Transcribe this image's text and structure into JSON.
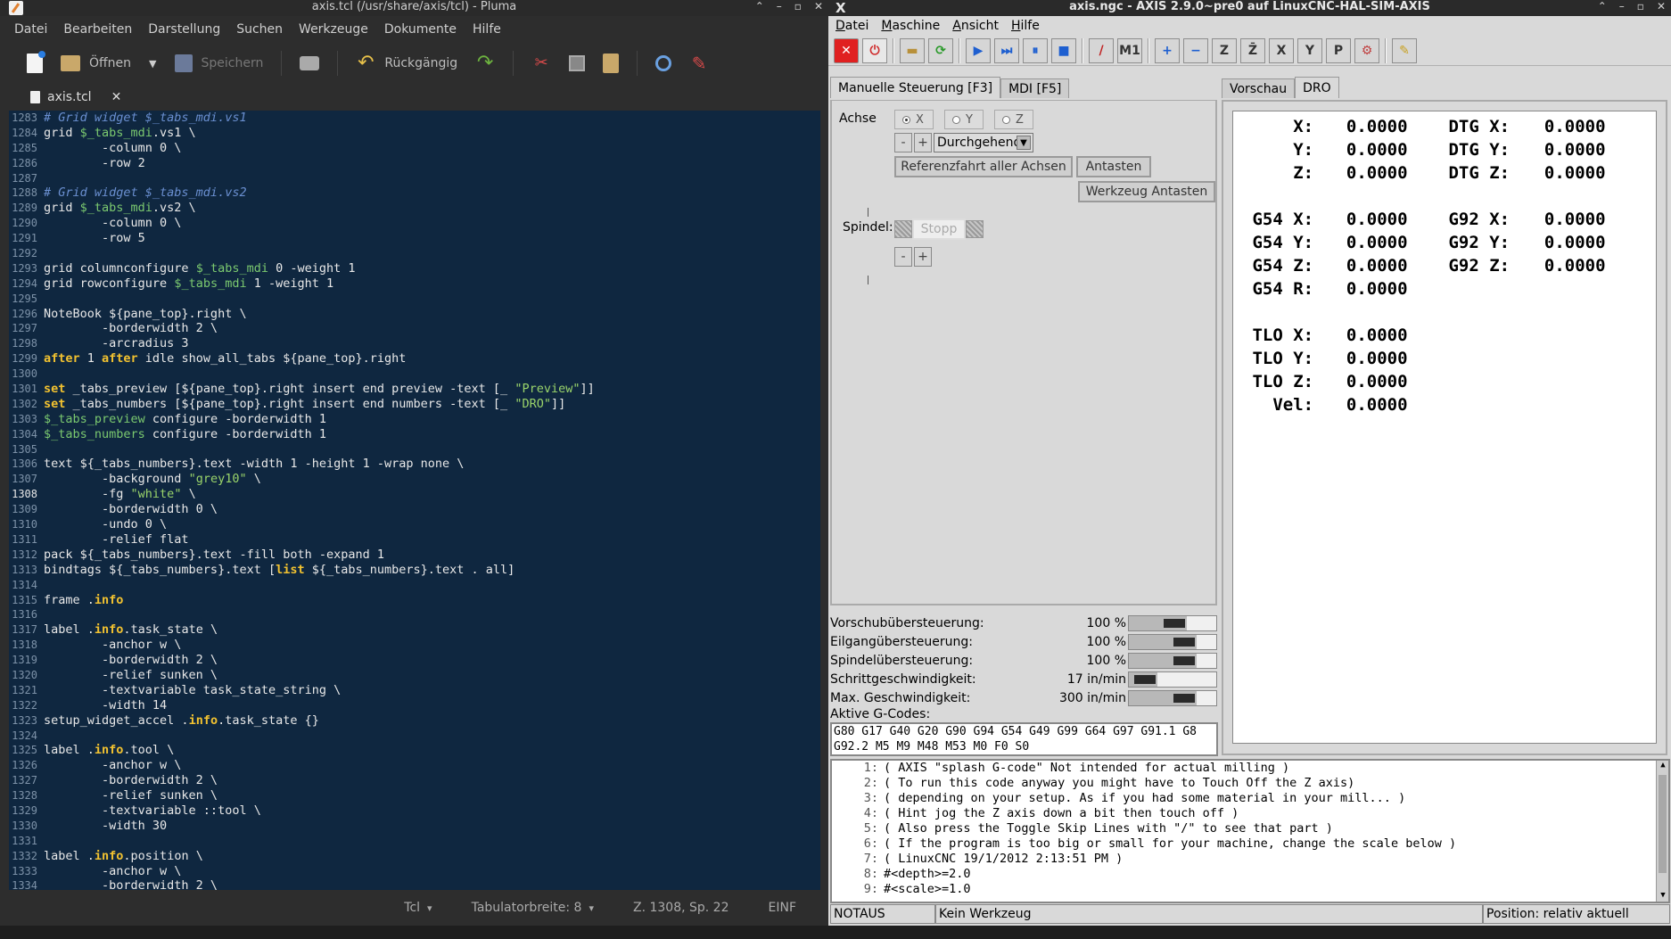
{
  "pluma": {
    "title": "axis.tcl (/usr/share/axis/tcl) - Pluma",
    "menu": [
      "Datei",
      "Bearbeiten",
      "Darstellung",
      "Suchen",
      "Werkzeuge",
      "Dokumente",
      "Hilfe"
    ],
    "toolbar": {
      "open": "Öffnen",
      "save": "Speichern",
      "undo": "Rückgängig"
    },
    "tab": {
      "label": "axis.tcl"
    },
    "status": {
      "language": "Tcl",
      "tabwidth": "Tabulatorbreite:  8",
      "position": "Z. 1308, Sp. 22",
      "mode": "EINF"
    },
    "current_line": "1308",
    "lines": [
      {
        "n": "1283",
        "html": "<span class='c'># Grid widget $_tabs_mdi.vs1</span>"
      },
      {
        "n": "1284",
        "html": "grid <span class='v'>$_tabs_mdi</span>.vs1 \\"
      },
      {
        "n": "1285",
        "html": "        -column 0 \\"
      },
      {
        "n": "1286",
        "html": "        -row 2"
      },
      {
        "n": "1287",
        "html": ""
      },
      {
        "n": "1288",
        "html": "<span class='c'># Grid widget $_tabs_mdi.vs2</span>"
      },
      {
        "n": "1289",
        "html": "grid <span class='v'>$_tabs_mdi</span>.vs2 \\"
      },
      {
        "n": "1290",
        "html": "        -column 0 \\"
      },
      {
        "n": "1291",
        "html": "        -row 5"
      },
      {
        "n": "1292",
        "html": ""
      },
      {
        "n": "1293",
        "html": "grid columnconfigure <span class='v'>$_tabs_mdi</span> 0 -weight 1"
      },
      {
        "n": "1294",
        "html": "grid rowconfigure <span class='v'>$_tabs_mdi</span> 1 -weight 1"
      },
      {
        "n": "1295",
        "html": ""
      },
      {
        "n": "1296",
        "html": "NoteBook ${pane_top}.right \\"
      },
      {
        "n": "1297",
        "html": "        -borderwidth 2 \\"
      },
      {
        "n": "1298",
        "html": "        -arcradius 3"
      },
      {
        "n": "1299",
        "html": "<span class='k'>after</span> 1 <span class='k'>after</span> idle show_all_tabs ${pane_top}.right"
      },
      {
        "n": "1300",
        "html": ""
      },
      {
        "n": "1301",
        "html": "<span class='k'>set</span> _tabs_preview [${pane_top}.right insert end preview -text [_ <span class='s'>\"Preview\"</span>]]"
      },
      {
        "n": "1302",
        "html": "<span class='k'>set</span> _tabs_numbers [${pane_top}.right insert end numbers -text [_ <span class='s'>\"DRO\"</span>]]"
      },
      {
        "n": "1303",
        "html": "<span class='v'>$_tabs_preview</span> configure -borderwidth 1"
      },
      {
        "n": "1304",
        "html": "<span class='v'>$_tabs_numbers</span> configure -borderwidth 1"
      },
      {
        "n": "1305",
        "html": ""
      },
      {
        "n": "1306",
        "html": "text ${_tabs_numbers}.text -width 1 -height 1 -wrap none \\"
      },
      {
        "n": "1307",
        "html": "        -background <span class='s'>\"grey10\"</span> \\"
      },
      {
        "n": "1308",
        "html": "        -fg <span class='s'>\"white\"</span> \\"
      },
      {
        "n": "1309",
        "html": "        -borderwidth 0 \\"
      },
      {
        "n": "1310",
        "html": "        -undo 0 \\"
      },
      {
        "n": "1311",
        "html": "        -relief flat"
      },
      {
        "n": "1312",
        "html": "pack ${_tabs_numbers}.text -fill both -expand 1"
      },
      {
        "n": "1313",
        "html": "bindtags ${_tabs_numbers}.text [<span class='k'>list</span> ${_tabs_numbers}.text . all]"
      },
      {
        "n": "1314",
        "html": ""
      },
      {
        "n": "1315",
        "html": "frame .<span class='k'>info</span>"
      },
      {
        "n": "1316",
        "html": ""
      },
      {
        "n": "1317",
        "html": "label .<span class='k'>info</span>.task_state \\"
      },
      {
        "n": "1318",
        "html": "        -anchor w \\"
      },
      {
        "n": "1319",
        "html": "        -borderwidth 2 \\"
      },
      {
        "n": "1320",
        "html": "        -relief sunken \\"
      },
      {
        "n": "1321",
        "html": "        -textvariable task_state_string \\"
      },
      {
        "n": "1322",
        "html": "        -width 14"
      },
      {
        "n": "1323",
        "html": "setup_widget_accel .<span class='k'>info</span>.task_state {}"
      },
      {
        "n": "1324",
        "html": ""
      },
      {
        "n": "1325",
        "html": "label .<span class='k'>info</span>.tool \\"
      },
      {
        "n": "1326",
        "html": "        -anchor w \\"
      },
      {
        "n": "1327",
        "html": "        -borderwidth 2 \\"
      },
      {
        "n": "1328",
        "html": "        -relief sunken \\"
      },
      {
        "n": "1329",
        "html": "        -textvariable ::tool \\"
      },
      {
        "n": "1330",
        "html": "        -width 30"
      },
      {
        "n": "1331",
        "html": ""
      },
      {
        "n": "1332",
        "html": "label .<span class='k'>info</span>.position \\"
      },
      {
        "n": "1333",
        "html": "        -anchor w \\"
      },
      {
        "n": "1334",
        "html": "        -borderwidth 2 \\"
      }
    ]
  },
  "axis": {
    "title": "axis.ngc - AXIS 2.9.0~pre0 auf LinuxCNC-HAL-SIM-AXIS",
    "menu": [
      "Datei",
      "Maschine",
      "Ansicht",
      "Hilfe"
    ],
    "tabs_left": [
      "Manuelle Steuerung [F3]",
      "MDI [F5]"
    ],
    "tabs_right": [
      "Vorschau",
      "DRO"
    ],
    "manual": {
      "axis_label": "Achse",
      "axes": [
        "X",
        "Y",
        "Z"
      ],
      "minus": "-",
      "plus": "+",
      "jog_mode": "Durchgehend",
      "home_all": "Referenzfahrt aller Achsen",
      "touch_off": "Antasten",
      "tool_touch_off": "Werkzeug Antasten",
      "spindle_label": "Spindel:",
      "spindle_stop": "Stopp"
    },
    "overrides": [
      {
        "name": "Vorschubübersteuerung:",
        "value": "100 %",
        "level": 0.55
      },
      {
        "name": "Eilgangübersteuerung:",
        "value": "100 %",
        "level": 0.7
      },
      {
        "name": "Spindelübersteuerung:",
        "value": "100 %",
        "level": 0.7
      },
      {
        "name": "Schrittgeschwindigkeit:",
        "value": "17 in/min",
        "level": 0.06
      },
      {
        "name": "Max. Geschwindigkeit:",
        "value": "300 in/min",
        "level": 0.7
      }
    ],
    "gcodes_label": "Aktive G-Codes:",
    "gcodes": [
      "G80 G17 G40 G20 G90 G94 G54 G49 G99 G64 G97 G91.1 G8",
      "G92.2 M5 M9 M48 M53 M0 F0 S0"
    ],
    "dro": {
      "rows": [
        {
          "l": "     X:",
          "v": "  0.0000",
          "r": " DTG X:",
          "rv": "  0.0000"
        },
        {
          "l": "     Y:",
          "v": "  0.0000",
          "r": " DTG Y:",
          "rv": "  0.0000"
        },
        {
          "l": "     Z:",
          "v": "  0.0000",
          "r": " DTG Z:",
          "rv": "  0.0000"
        },
        {
          "l": "",
          "v": "",
          "r": "",
          "rv": ""
        },
        {
          "l": " G54 X:",
          "v": "  0.0000",
          "r": " G92 X:",
          "rv": "  0.0000"
        },
        {
          "l": " G54 Y:",
          "v": "  0.0000",
          "r": " G92 Y:",
          "rv": "  0.0000"
        },
        {
          "l": " G54 Z:",
          "v": "  0.0000",
          "r": " G92 Z:",
          "rv": "  0.0000"
        },
        {
          "l": " G54 R:",
          "v": "  0.0000",
          "r": "",
          "rv": ""
        },
        {
          "l": "",
          "v": "",
          "r": "",
          "rv": ""
        },
        {
          "l": " TLO X:",
          "v": "  0.0000",
          "r": "",
          "rv": ""
        },
        {
          "l": " TLO Y:",
          "v": "  0.0000",
          "r": "",
          "rv": ""
        },
        {
          "l": " TLO Z:",
          "v": "  0.0000",
          "r": "",
          "rv": ""
        },
        {
          "l": "   Vel:",
          "v": "  0.0000",
          "r": "",
          "rv": ""
        }
      ]
    },
    "program": [
      {
        "n": "1:",
        "t": "( AXIS \"splash G-code\" Not intended for actual milling )"
      },
      {
        "n": "2:",
        "t": "( To run this code anyway you might have to Touch Off the Z axis)"
      },
      {
        "n": "3:",
        "t": "( depending on your setup. As if you had some material in your mill... )"
      },
      {
        "n": "4:",
        "t": "( Hint jog the Z axis down a bit then touch off )"
      },
      {
        "n": "5:",
        "t": "( Also press the Toggle Skip Lines with \"/\" to see that part )"
      },
      {
        "n": "6:",
        "t": "( If the program is too big or small for your machine, change the scale below )"
      },
      {
        "n": "7:",
        "t": "( LinuxCNC 19/1/2012 2:13:51 PM )"
      },
      {
        "n": "8:",
        "t": "#<depth>=2.0"
      },
      {
        "n": "9:",
        "t": "#<scale>=1.0"
      }
    ],
    "status": {
      "state": "NOTAUS",
      "tool": "Kein Werkzeug",
      "position": "Position: relativ aktuell"
    }
  }
}
